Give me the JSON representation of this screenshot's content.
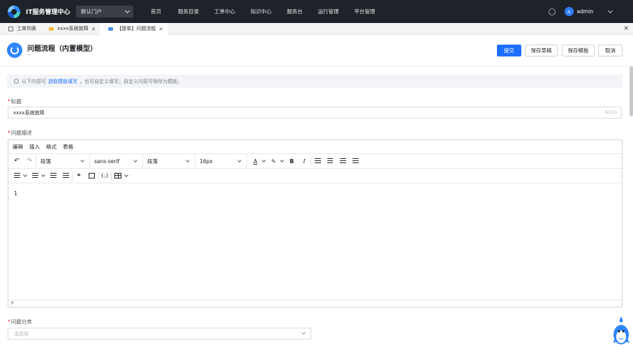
{
  "nav": {
    "app_title": "IT服务管理中心",
    "portal": "默认门户",
    "menu": [
      "首页",
      "服务目录",
      "工单中心",
      "知识中心",
      "服务台",
      "运行管理",
      "平台管理"
    ],
    "avatar_letter": "a",
    "user": "admin"
  },
  "tabs": [
    {
      "label": "工单列表",
      "icon": "document-icon",
      "closable": false
    },
    {
      "label": "xxxx系统故障",
      "icon": "folder-icon",
      "closable": true
    },
    {
      "label": "【提单】问题流程",
      "icon": "form-icon",
      "closable": true,
      "active": true
    }
  ],
  "tabbar_close": "×",
  "page": {
    "title": "问题流程（内置模型）",
    "subtitle": "--",
    "buttons": {
      "submit": "提交",
      "save_draft": "保存草稿",
      "save_template": "保存模板",
      "cancel": "取消"
    }
  },
  "tip": {
    "before": "以下内容可",
    "link": "选取模板填写",
    "after": "，也可自定义填写；自定义内容可保存为模板。"
  },
  "form": {
    "title_label": "标题",
    "title_value": "xxxx系统故障",
    "title_count": "8/150",
    "desc_label": "问题描述",
    "category_label": "问题分类",
    "category_placeholder": "请选择"
  },
  "editor": {
    "menubar": [
      "编辑",
      "插入",
      "格式",
      "表格"
    ],
    "block_format": "段落",
    "font_family": "sans-serif",
    "paragraph": "段落",
    "font_size": "16px",
    "content": "1",
    "status_path": "P",
    "icons": [
      "undo-icon",
      "redo-icon",
      "font-color-icon",
      "highlight-icon",
      "bold-icon",
      "italic-icon",
      "align-left-icon",
      "align-center-icon",
      "align-right-icon",
      "justify-icon",
      "bullet-list-icon",
      "numbered-list-icon",
      "outdent-icon",
      "indent-icon",
      "link-icon",
      "image-icon",
      "code-icon",
      "table-icon"
    ]
  },
  "colors": {
    "nav_bg": "#1e2229",
    "primary": "#1f6fff",
    "required": "#f5222d"
  }
}
